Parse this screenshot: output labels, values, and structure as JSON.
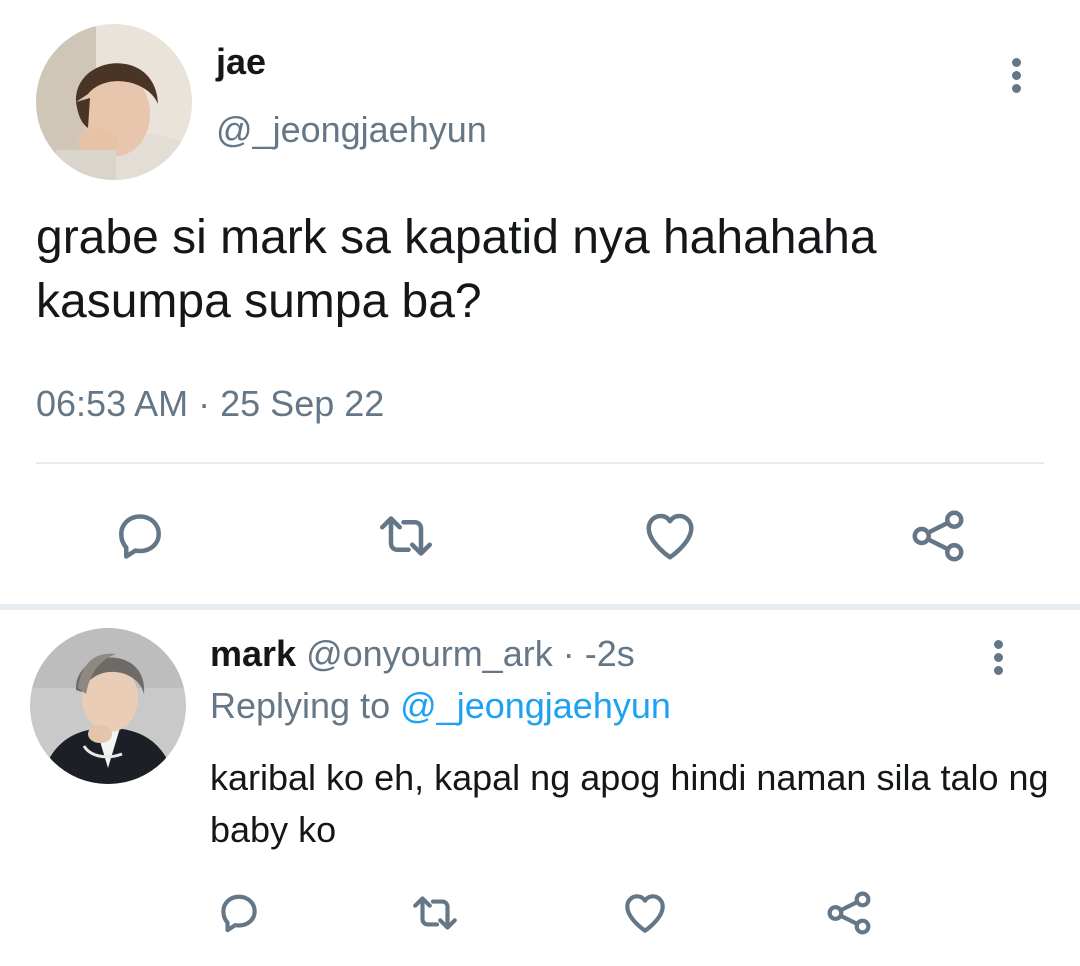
{
  "main_tweet": {
    "display_name": "jae",
    "handle": "@_jeongjaehyun",
    "text": "grabe si mark sa kapatid nya hahahaha kasumpa sumpa ba?",
    "timestamp": "06:53 AM",
    "separator": "·",
    "date": "25 Sep 22",
    "icons": {
      "more": "more-vertical-icon",
      "reply": "reply-icon",
      "retweet": "retweet-icon",
      "like": "heart-icon",
      "share": "share-icon"
    }
  },
  "reply_tweet": {
    "display_name": "mark",
    "handle": "@onyourm_ark",
    "separator": "·",
    "time": "-2s",
    "replying_prefix": "Replying to",
    "replying_handle": "@_jeongjaehyun",
    "text": "karibal ko eh, kapal ng apog hindi naman sila talo ng baby ko"
  },
  "colors": {
    "text_primary": "#14171a",
    "text_secondary": "#657786",
    "link": "#1da1f2",
    "divider": "#e6ecf0"
  }
}
